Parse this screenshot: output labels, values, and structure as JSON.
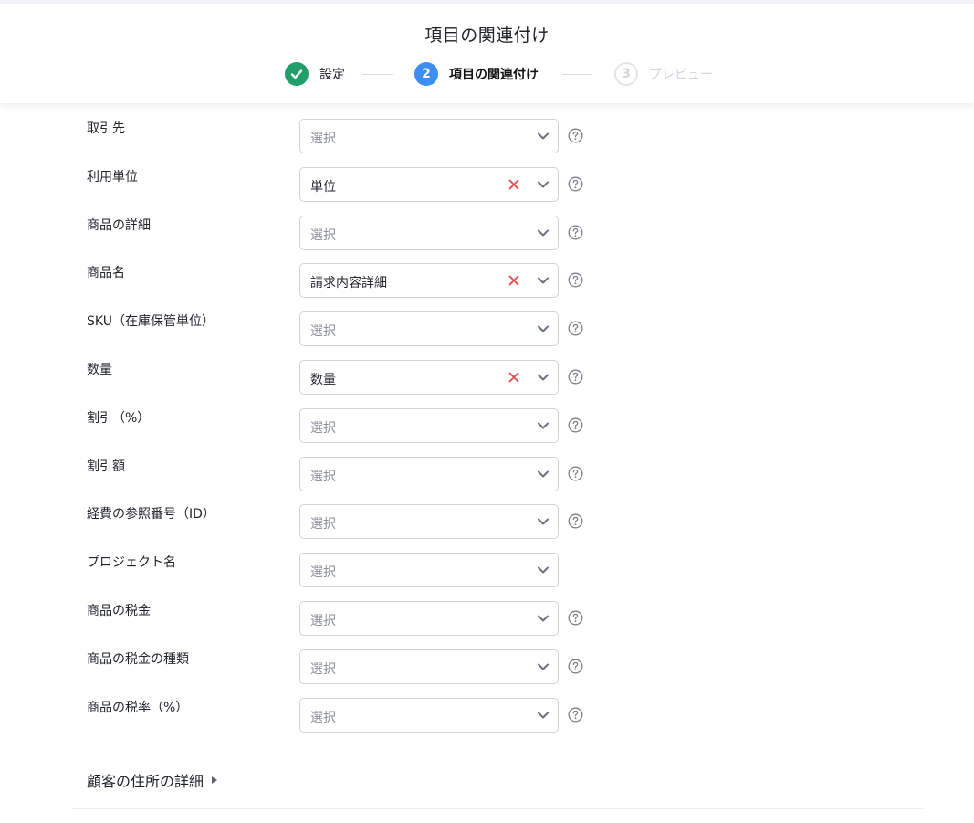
{
  "header": {
    "title": "項目の関連付け"
  },
  "stepper": {
    "steps": [
      {
        "number": "",
        "label": "設定",
        "state": "done"
      },
      {
        "number": "2",
        "label": "項目の関連付け",
        "state": "active"
      },
      {
        "number": "3",
        "label": "プレビュー",
        "state": "pending"
      }
    ]
  },
  "fields": [
    {
      "label": "取引先",
      "value": "選択",
      "filled": false,
      "help": true
    },
    {
      "label": "利用単位",
      "value": "単位",
      "filled": true,
      "help": true
    },
    {
      "label": "商品の詳細",
      "value": "選択",
      "filled": false,
      "help": true
    },
    {
      "label": "商品名",
      "value": "請求内容詳細",
      "filled": true,
      "help": true
    },
    {
      "label": "SKU（在庫保管単位）",
      "value": "選択",
      "filled": false,
      "help": true
    },
    {
      "label": "数量",
      "value": "数量",
      "filled": true,
      "help": true
    },
    {
      "label": "割引（%）",
      "value": "選択",
      "filled": false,
      "help": true
    },
    {
      "label": "割引額",
      "value": "選択",
      "filled": false,
      "help": true
    },
    {
      "label": "経費の参照番号（ID）",
      "value": "選択",
      "filled": false,
      "help": true
    },
    {
      "label": "プロジェクト名",
      "value": "選択",
      "filled": false,
      "help": false
    },
    {
      "label": "商品の税金",
      "value": "選択",
      "filled": false,
      "help": true
    },
    {
      "label": "商品の税金の種類",
      "value": "選択",
      "filled": false,
      "help": true
    },
    {
      "label": "商品の税率（%）",
      "value": "選択",
      "filled": false,
      "help": true
    }
  ],
  "section": {
    "title": "顧客の住所の詳細"
  },
  "colors": {
    "done": "#229e6b",
    "active": "#3d8df2",
    "clear": "#e5484d",
    "border": "#cfd3d9"
  },
  "icons": {
    "done_step": "check-icon",
    "clear": "close-icon",
    "dropdown": "chevron-down-icon",
    "help": "question-circle-icon",
    "section": "caret-right-icon"
  }
}
